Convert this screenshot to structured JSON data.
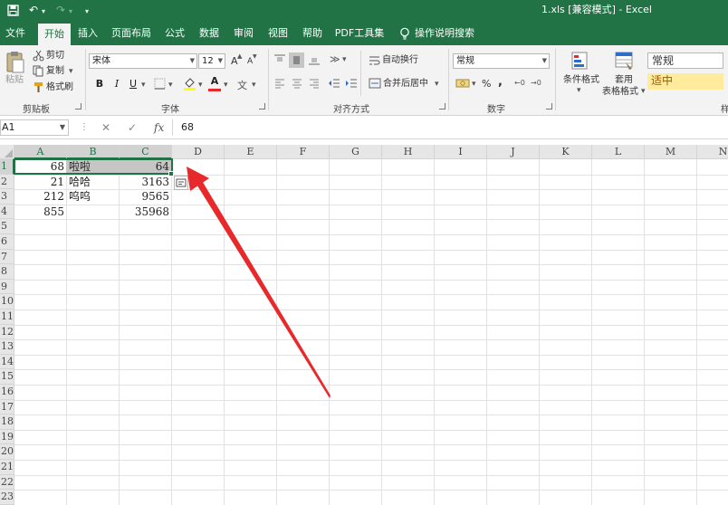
{
  "window": {
    "title": "1.xls  [兼容模式]  -  Excel",
    "quick_access": {
      "undo_glyph": "↶",
      "redo_glyph": "↷",
      "dropdown_glyph": "▾",
      "more_glyph": "▾"
    }
  },
  "tabs": [
    {
      "label": "文件"
    },
    {
      "label": "开始"
    },
    {
      "label": "插入"
    },
    {
      "label": "页面布局"
    },
    {
      "label": "公式"
    },
    {
      "label": "数据"
    },
    {
      "label": "审阅"
    },
    {
      "label": "视图"
    },
    {
      "label": "帮助"
    },
    {
      "label": "PDF工具集"
    }
  ],
  "active_tab": "开始",
  "tell_me": "操作说明搜索",
  "ribbon": {
    "clipboard": {
      "paste": "粘贴",
      "cut": "剪切",
      "copy": "复制",
      "format_painter": "格式刷",
      "label": "剪贴板"
    },
    "font": {
      "name": "宋体",
      "size": "12",
      "bold": "B",
      "italic": "I",
      "underline": "U",
      "grow": "A",
      "shrink": "A",
      "color_a": "A",
      "label": "字体"
    },
    "alignment": {
      "wrap": "自动换行",
      "merge": "合并后居中",
      "label": "对齐方式"
    },
    "number": {
      "format": "常规",
      "percent": "%",
      "comma": ",",
      "label": "数字"
    },
    "styles": {
      "conditional": "条件格式",
      "table_line1": "套用",
      "table_line2": "表格格式",
      "normal": "常规",
      "neutral": "适中",
      "label": "样"
    }
  },
  "formula_bar": {
    "name_box": "A1",
    "cancel": "✕",
    "enter": "✓",
    "fx": "fx",
    "content": "68"
  },
  "columns": [
    "A",
    "B",
    "C",
    "D",
    "E",
    "F",
    "G",
    "H",
    "I",
    "J",
    "K",
    "L",
    "M",
    "N"
  ],
  "rows": [
    "1",
    "2",
    "3",
    "4",
    "5",
    "6",
    "7",
    "8",
    "9",
    "10",
    "11",
    "12",
    "13",
    "14",
    "15",
    "16",
    "17",
    "18",
    "19",
    "20",
    "21",
    "22",
    "23"
  ],
  "cells": {
    "A1": "68",
    "B1": "啦啦",
    "C1": "64",
    "A2": "21",
    "B2": "哈哈",
    "C2": "3163",
    "A3": "212",
    "B3": "呜呜",
    "C3": "9565",
    "A4": "855",
    "C4": "35968"
  },
  "colors": {
    "excel_green": "#217346",
    "arrow_red": "#e8292b",
    "neutral_style": "#ffeb9c"
  }
}
